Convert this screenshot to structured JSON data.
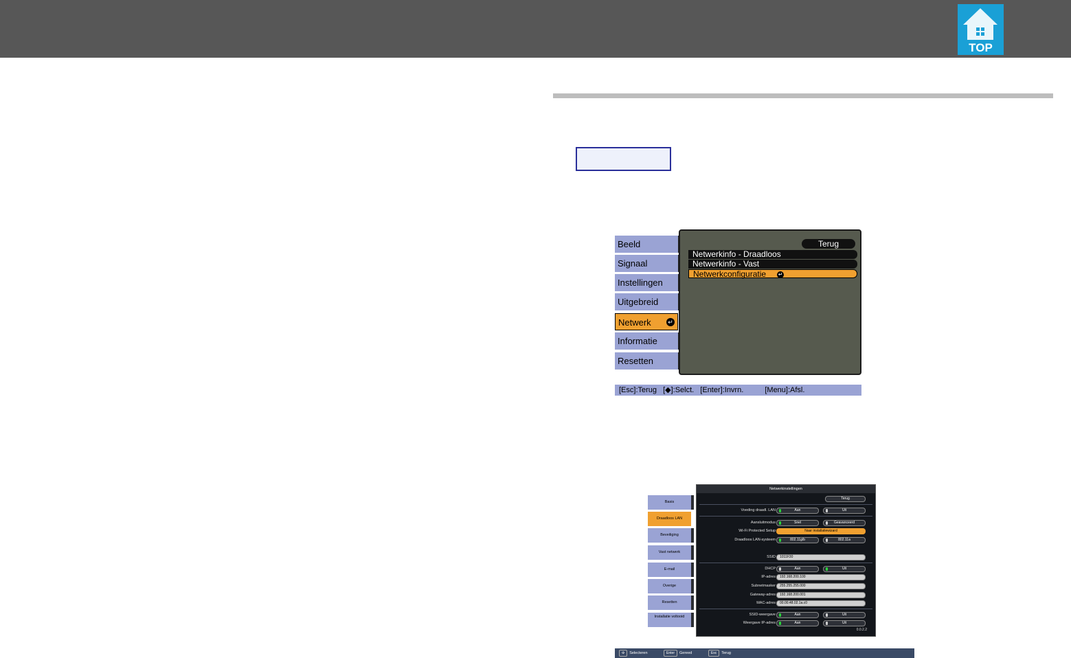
{
  "header": {
    "logo_text": "TOP",
    "logo_icon": "house-icon",
    "accent_color": "#1aa0d6"
  },
  "menu1": {
    "tabs": [
      {
        "label": "Beeld"
      },
      {
        "label": "Signaal"
      },
      {
        "label": "Instellingen"
      },
      {
        "label": "Uitgebreid"
      },
      {
        "label": "Netwerk",
        "active": true
      },
      {
        "label": "Informatie"
      },
      {
        "label": "Resetten"
      }
    ],
    "back_label": "Terug",
    "items": [
      {
        "label": "Netwerkinfo - Draadloos"
      },
      {
        "label": "Netwerkinfo - Vast"
      },
      {
        "label": "Netwerkconfiguratie",
        "selected": true
      }
    ],
    "footer": {
      "esc": "[Esc]:Terug",
      "select": "[◆]:Selct.",
      "enter": "[Enter]:Invrn.",
      "menu": "[Menu]:Afsl."
    }
  },
  "menu2": {
    "title": "Netwerkinstellingen",
    "back_label": "Terug",
    "tabs": [
      {
        "label": "Basis"
      },
      {
        "label": "Draadloos LAN",
        "active": true
      },
      {
        "label": "Beveiliging"
      },
      {
        "label": "Vast netwerk"
      },
      {
        "label": "E-mail"
      },
      {
        "label": "Overige"
      },
      {
        "label": "Resetten"
      },
      {
        "label": "Installatie voltooid"
      }
    ],
    "rows": {
      "wireless_power": {
        "label": "Voeding draadl. LAN",
        "opt1": "Aan",
        "opt2": "Uit"
      },
      "connection_mode": {
        "label": "Aansluitmodus",
        "opt1": "Snel",
        "opt2": "Geavanceerd"
      },
      "wps": {
        "label": "Wi-Fi Protected Setup",
        "value": "Naar installatiewizard"
      },
      "lan_system": {
        "label": "Draadloos LAN-systeem",
        "opt1": "802.11g/b",
        "opt2": "802.11a"
      },
      "ssid": {
        "label": "SSID",
        "value": "1011F30"
      },
      "dhcp": {
        "label": "DHCP",
        "opt1": "Aan",
        "opt2": "Uit"
      },
      "ip": {
        "label": "IP-adres",
        "value": "192.168.200.100"
      },
      "subnet": {
        "label": "Subnetmasker",
        "value": "255.255.255.000"
      },
      "gateway": {
        "label": "Gateway-adres",
        "value": "192.168.200.001"
      },
      "mac": {
        "label": "MAC-adres",
        "value": "00.00.48.02.1a.c0"
      },
      "ssid_display": {
        "label": "SSID-weergave",
        "opt1": "Aan",
        "opt2": "Uit"
      },
      "ip_display": {
        "label": "Weergave IP-adres",
        "opt1": "Aan",
        "opt2": "Uit"
      }
    },
    "version": "0.0.2.2",
    "footer": {
      "select_key": "✣",
      "select_label": "Selecteren",
      "enter_key": "Enter",
      "enter_label": "Gereed",
      "esc_key": "Esc",
      "esc_label": "Terug"
    }
  }
}
